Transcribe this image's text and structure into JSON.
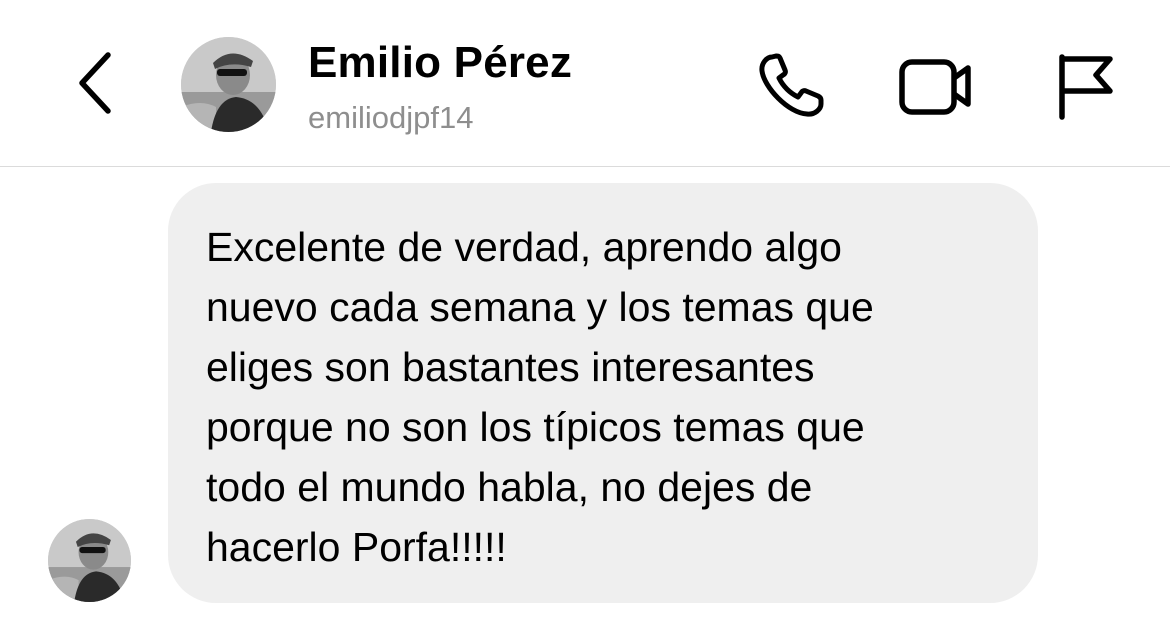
{
  "header": {
    "back_icon": "chevron-left-icon",
    "contact_name": "Emilio Pérez",
    "contact_username": "emiliodjpf14",
    "actions": [
      {
        "icon": "phone-icon"
      },
      {
        "icon": "video-camera-icon"
      },
      {
        "icon": "flag-icon"
      }
    ]
  },
  "messages": [
    {
      "sender": "Emilio Pérez",
      "text": "Excelente de verdad, aprendo algo\nnuevo cada semana y los temas que\neliges son bastantes interesantes\nporque no son los típicos temas que\ntodo el mundo habla, no dejes de\nhacerlo Porfa!!!!!"
    }
  ],
  "colors": {
    "background": "#ffffff",
    "bubble": "#efefef",
    "text": "#000000",
    "secondary_text": "#8e8e8e",
    "divider": "#dbdbdb"
  }
}
